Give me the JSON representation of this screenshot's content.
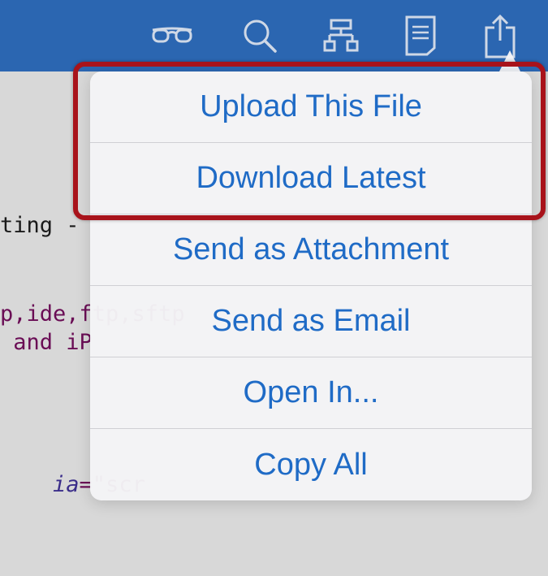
{
  "toolbar": {
    "icons": [
      "glasses-icon",
      "search-icon",
      "hierarchy-icon",
      "document-icon",
      "share-icon"
    ]
  },
  "editor": {
    "lines": [
      {
        "a": "ting - "
      },
      {
        "a": "p,ide,ftp,sftp"
      },
      {
        "a": " and iP"
      },
      {
        "a": "ia",
        "b": "=\"scr"
      }
    ]
  },
  "menu": {
    "items": [
      "Upload This File",
      "Download Latest",
      "Send as Attachment",
      "Send as Email",
      "Open In...",
      "Copy All"
    ]
  },
  "colors": {
    "toolbar_bg": "#2b66b1",
    "menu_text": "#1f6bc6",
    "highlight": "#a8131b"
  }
}
